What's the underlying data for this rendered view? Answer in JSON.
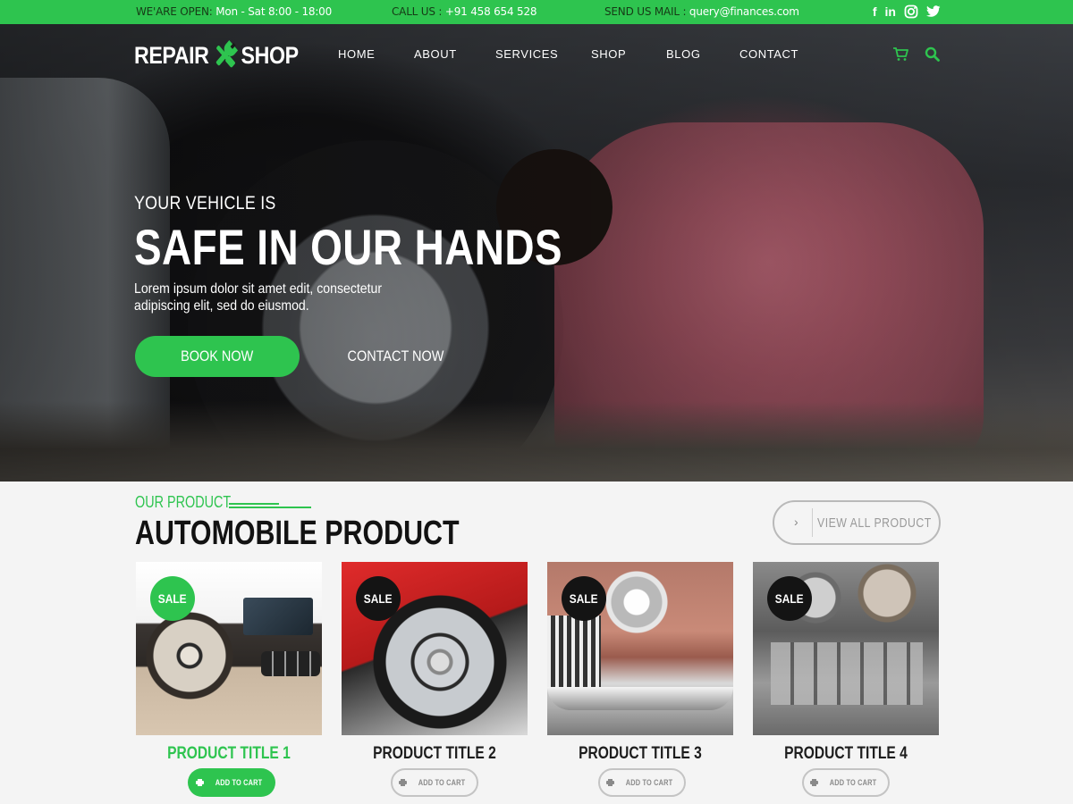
{
  "topbar": {
    "open_label": "WE'ARE OPEN:",
    "open_hours": "Mon - Sat 8:00 - 18:00",
    "call_label": "CALL US :",
    "call_number": "+91 458 654 528",
    "mail_label": "SEND US MAIL :",
    "mail_address": "query@finances.com",
    "social": [
      "facebook-icon",
      "linkedin-icon",
      "instagram-icon",
      "twitter-icon"
    ],
    "social_glyphs": {
      "facebook": "f",
      "linkedin": "in"
    }
  },
  "brand": {
    "left": "REPAIR",
    "right": "SHOP",
    "accent": "#2ec44f"
  },
  "nav": {
    "items": [
      "HOME",
      "ABOUT",
      "SERVICES",
      "SHOP",
      "BLOG",
      "CONTACT"
    ],
    "icons": [
      "cart-icon",
      "search-icon"
    ]
  },
  "hero": {
    "subtitle": "YOUR VEHICLE IS",
    "title": "SAFE IN OUR HANDS",
    "text": "Lorem ipsum dolor sit amet edit, consectetur adipiscing elit, sed do eiusmod.",
    "primary_button": "BOOK NOW",
    "secondary_button": "CONTACT NOW"
  },
  "products_section": {
    "kicker": "OUR PRODUCT",
    "title": "AUTOMOBILE PRODUCT",
    "view_all": "VIEW ALL PRODUCT",
    "view_all_chevron": "›",
    "products": [
      {
        "title": "PRODUCT TITLE 1",
        "badge": "SALE",
        "cart": "ADD TO CART",
        "highlighted": true
      },
      {
        "title": "PRODUCT TITLE 2",
        "badge": "SALE",
        "cart": "ADD TO CART",
        "highlighted": false
      },
      {
        "title": "PRODUCT TITLE 3",
        "badge": "SALE",
        "cart": "ADD TO CART",
        "highlighted": false
      },
      {
        "title": "PRODUCT TITLE 4",
        "badge": "SALE",
        "cart": "ADD TO CART",
        "highlighted": false
      }
    ]
  },
  "colors": {
    "green": "#2ec44f",
    "dark_badge": "#141414",
    "text_dark": "#121212"
  }
}
